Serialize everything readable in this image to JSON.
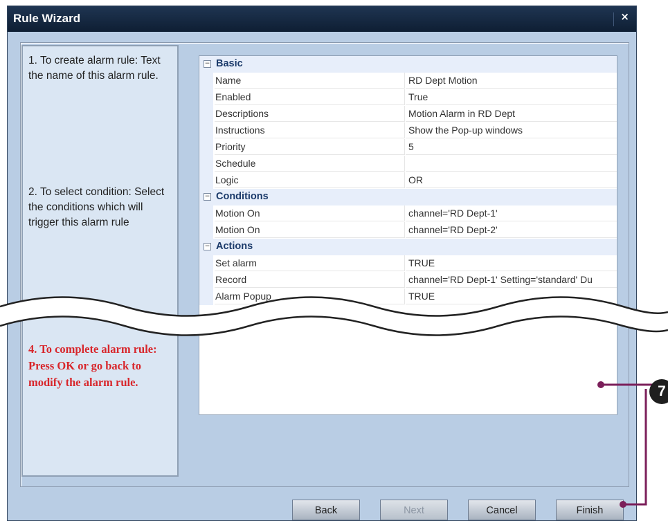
{
  "window": {
    "title": "Rule Wizard",
    "close_glyph": "×"
  },
  "steps": {
    "step1": "1. To create alarm rule: Text the name of this alarm rule.",
    "step2": "2. To select condition: Select the conditions which will trigger this alarm rule",
    "step4": "4. To complete alarm rule: Press OK or go back to modify the alarm rule."
  },
  "sections": [
    {
      "label": "Basic",
      "toggle": "−",
      "rows": [
        {
          "name": "Name",
          "value": "RD Dept Motion"
        },
        {
          "name": "Enabled",
          "value": "True"
        },
        {
          "name": "Descriptions",
          "value": "Motion Alarm in RD Dept"
        },
        {
          "name": "Instructions",
          "value": "Show the Pop-up windows"
        },
        {
          "name": "Priority",
          "value": "5"
        },
        {
          "name": "Schedule",
          "value": ""
        },
        {
          "name": "Logic",
          "value": "OR"
        }
      ]
    },
    {
      "label": "Conditions",
      "toggle": "−",
      "rows": [
        {
          "name": "Motion On",
          "value": "channel='RD Dept-1'"
        },
        {
          "name": "Motion On",
          "value": "channel='RD Dept-2'"
        }
      ]
    },
    {
      "label": "Actions",
      "toggle": "−",
      "rows": [
        {
          "name": "Set alarm",
          "value": "TRUE"
        },
        {
          "name": "Record",
          "value": "channel='RD Dept-1' Setting='standard' Du"
        },
        {
          "name": "Alarm Popup",
          "value": "TRUE"
        }
      ]
    }
  ],
  "buttons": {
    "back": "Back",
    "next": "Next",
    "cancel": "Cancel",
    "finish": "Finish"
  },
  "callout": {
    "number": "7",
    "color": "#7b1f5a"
  },
  "colors": {
    "title_bar": "#0e1e33",
    "window_bg": "#b9cde4",
    "step4_text": "#d8262b",
    "section_bg": "#e7eefa"
  }
}
